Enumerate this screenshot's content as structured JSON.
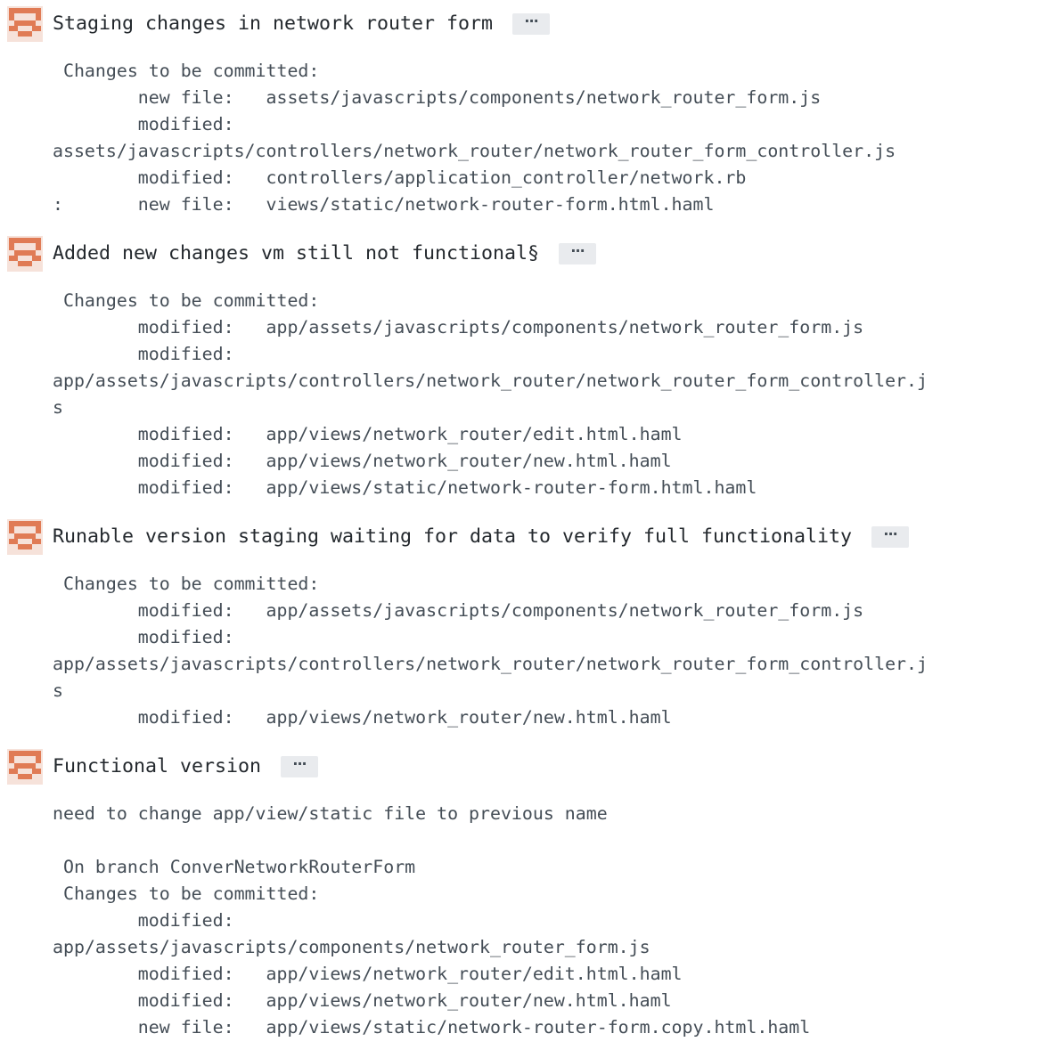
{
  "commits": [
    {
      "title": "Staging changes in network router form",
      "more_label": "···",
      "body": " Changes to be committed:\n        new file:   assets/javascripts/components/network_router_form.js\n        modified:\nassets/javascripts/controllers/network_router/network_router_form_controller.js\n        modified:   controllers/application_controller/network.rb\n:       new file:   views/static/network-router-form.html.haml"
    },
    {
      "title": "Added new changes vm still not functional§",
      "more_label": "···",
      "body": " Changes to be committed:\n        modified:   app/assets/javascripts/components/network_router_form.js\n        modified:\napp/assets/javascripts/controllers/network_router/network_router_form_controller.j\ns\n        modified:   app/views/network_router/edit.html.haml\n        modified:   app/views/network_router/new.html.haml\n        modified:   app/views/static/network-router-form.html.haml"
    },
    {
      "title": "Runable version staging waiting for data to verify full functionality",
      "more_label": "···",
      "body": " Changes to be committed:\n        modified:   app/assets/javascripts/components/network_router_form.js\n        modified:\napp/assets/javascripts/controllers/network_router/network_router_form_controller.j\ns\n        modified:   app/views/network_router/new.html.haml"
    },
    {
      "title": "Functional version",
      "more_label": "···",
      "body": "need to change app/view/static file to previous name\n\n On branch ConverNetworkRouterForm\n Changes to be committed:\n        modified:\napp/assets/javascripts/components/network_router_form.js\n        modified:   app/views/network_router/edit.html.haml\n        modified:   app/views/network_router/new.html.haml\n        new file:   app/views/static/network-router-form.copy.html.haml"
    }
  ],
  "colors": {
    "avatar": "#e07b55",
    "avatar_bg": "#f2d6cb",
    "button_bg": "#e9ebee"
  },
  "icons": {
    "avatar": "identicon-avatar",
    "more": "ellipsis-icon"
  }
}
